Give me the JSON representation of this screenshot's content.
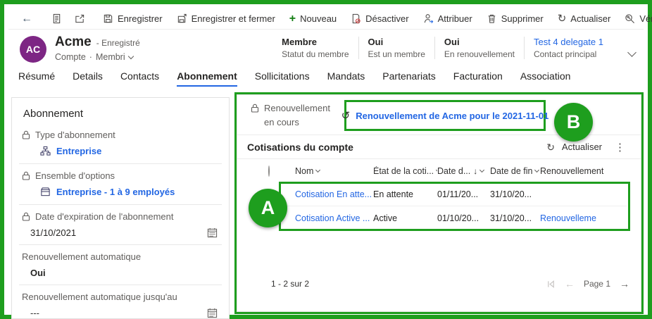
{
  "toolbar": {
    "buttons": [
      "Enregistrer",
      "Enregistrer et fermer",
      "Nouveau",
      "Désactiver",
      "Attribuer",
      "Supprimer",
      "Actualiser",
      "Vérifier l'accès"
    ],
    "overflow": "⋮"
  },
  "header": {
    "avatar": "AC",
    "title": "Acme",
    "save_status": "- Enregistré",
    "entity": "Compte",
    "separator": "·",
    "form_selector": "Membri",
    "fields": [
      {
        "value": "Membre",
        "label": "Statut du membre"
      },
      {
        "value": "Oui",
        "label": "Est un membre"
      },
      {
        "value": "Oui",
        "label": "En renouvellement"
      },
      {
        "value": "Test 4 delegate 1",
        "label": "Contact principal"
      }
    ]
  },
  "tabs": [
    "Résumé",
    "Details",
    "Contacts",
    "Abonnement",
    "Sollicitations",
    "Mandats",
    "Partenariats",
    "Facturation",
    "Association"
  ],
  "active_tab": "Abonnement",
  "sidebar": {
    "title": "Abonnement",
    "type_label": "Type d'abonnement",
    "type_value": "Entreprise",
    "optionset_label": "Ensemble d'options",
    "optionset_value": "Entreprise - 1 à 9 employés",
    "expiry_label": "Date d'expiration de l'abonnement",
    "expiry_value": "31/10/2021",
    "autorenew_label": "Renouvellement automatique",
    "autorenew_value": "Oui",
    "autorenew_until_label": "Renouvellement automatique jusqu'au",
    "autorenew_until_value": "---"
  },
  "main": {
    "renewal_label": "Renouvellement en cours",
    "renewal_link": "Renouvellement de Acme pour le 2021-11-01",
    "subgrid_title": "Cotisations du compte",
    "refresh_label": "Actualiser",
    "overflow": "⋮",
    "table": {
      "headers": [
        "Nom",
        "État de la coti...",
        "Date d...",
        "Date de fin",
        "Renouvellement"
      ],
      "rows": [
        {
          "name": "Cotisation En atte...",
          "status": "En attente",
          "start": "01/11/20...",
          "end": "31/10/20...",
          "renewal": ""
        },
        {
          "name": "Cotisation Active ...",
          "status": "Active",
          "start": "01/10/20...",
          "end": "31/10/20...",
          "renewal": "Renouvelleme"
        }
      ]
    },
    "record_count": "1 - 2 sur 2",
    "page_label": "Page 1"
  },
  "annotations": {
    "a": "A",
    "b": "B"
  },
  "icons": {
    "back": "←",
    "history": "↺",
    "refresh": "↻",
    "sort_desc": "↓",
    "prev": "←",
    "next": "→",
    "plus": "+"
  },
  "colors": {
    "annotation_green": "#1E9E1E",
    "link_blue": "#2266E3",
    "avatar_purple": "#7D2684",
    "active_tab_underline": "#2266E3"
  }
}
